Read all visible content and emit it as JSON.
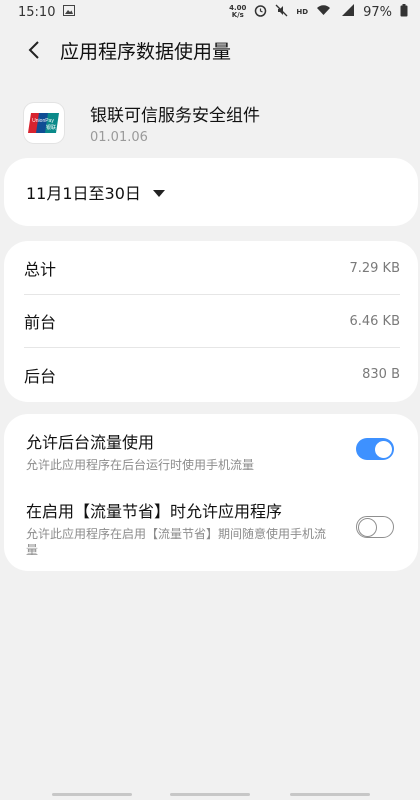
{
  "status_bar": {
    "time": "15:10",
    "speed": "4.00",
    "speed_unit": "K/s",
    "hd": "HD",
    "network": "4G",
    "battery": "97%"
  },
  "header": {
    "title": "应用程序数据使用量"
  },
  "app": {
    "name": "银联可信服务安全组件",
    "version": "01.01.06",
    "icon_text": "UnionPay",
    "icon_subtext": "银联"
  },
  "date_range": {
    "label": "11月1日至30日"
  },
  "stats": [
    {
      "label": "总计",
      "value": "7.29 KB"
    },
    {
      "label": "前台",
      "value": "6.46 KB"
    },
    {
      "label": "后台",
      "value": "830 B"
    }
  ],
  "settings": [
    {
      "title": "允许后台流量使用",
      "desc": "允许此应用程序在后台运行时使用手机流量",
      "enabled": true
    },
    {
      "title": "在启用【流量节省】时允许应用程序",
      "desc": "允许此应用程序在启用【流量节省】期间随意使用手机流量",
      "enabled": false
    }
  ],
  "colors": {
    "accent": "#3e91ff",
    "background": "#f1f1f1",
    "card": "#ffffff"
  }
}
